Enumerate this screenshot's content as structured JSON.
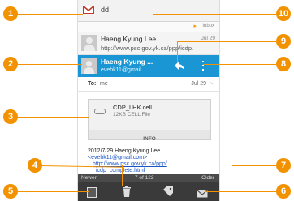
{
  "header": {
    "title": "dd"
  },
  "callouts": [
    "1",
    "2",
    "3",
    "4",
    "5",
    "6",
    "7",
    "8",
    "9",
    "10"
  ],
  "inbox_label": "Inbox",
  "threads": [
    {
      "sender": "Haeng Kyung Lee",
      "preview": "http://www.psc.gov.yk.ca/ppp/icdp.",
      "date": "Jul 29"
    },
    {
      "sender": "Haeng Kyung ...",
      "preview": "evehk11@gmail..."
    }
  ],
  "to_line": {
    "label": "To:",
    "value": "me",
    "date": "Jul 29"
  },
  "attachment": {
    "name": "CDP_LHK.cell",
    "info": "12KB CELL File",
    "button": "INFO"
  },
  "body": {
    "line1": "2012/7/29 Haeng Kyung Lee",
    "email": "<evehk11@gmail.com>",
    "link1": "http://www.psc.gov.yk.ca/ppp/",
    "link2": "icdp_complete.html"
  },
  "nav": {
    "newer": "Newer",
    "counter": "7 of 122",
    "older": "Older"
  },
  "colors": {
    "accent": "#f39200",
    "selected": "#1a96d4",
    "bar": "#4a4a4a"
  }
}
